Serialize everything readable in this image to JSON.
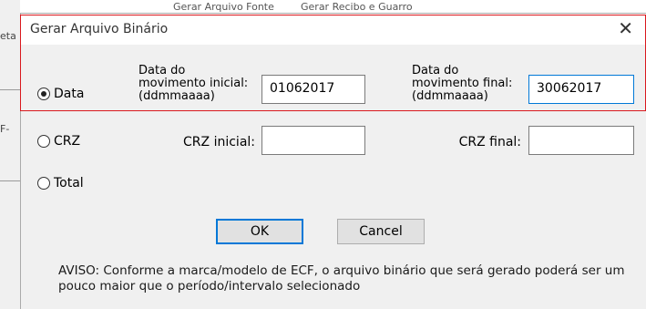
{
  "background": {
    "fragments": [
      "eta",
      "F-"
    ],
    "top_text": [
      "Gerar Arquivo Fonte",
      "Gerar Recibo e Guarro"
    ]
  },
  "dialog": {
    "title": "Gerar Arquivo Binário",
    "close_glyph": "✕",
    "options": {
      "data": {
        "label": "Data",
        "checked": true
      },
      "crz": {
        "label": "CRZ",
        "checked": false
      },
      "total": {
        "label": "Total",
        "checked": false
      }
    },
    "data_row": {
      "initial_label": [
        "Data do",
        "movimento inicial:",
        "(ddmmaaaa)"
      ],
      "initial_value": "01062017",
      "final_label": [
        "Data do",
        "movimento final:",
        "(ddmmaaaa)"
      ],
      "final_value": "30062017"
    },
    "crz_row": {
      "initial_label": "CRZ inicial:",
      "initial_value": "",
      "final_label": "CRZ final:",
      "final_value": ""
    },
    "buttons": {
      "ok": "OK",
      "cancel": "Cancel"
    },
    "notice": "AVISO: Conforme a marca/modelo de ECF, o arquivo binário que será gerado poderá ser um pouco maior que o período/intervalo selecionado"
  },
  "colors": {
    "highlight": "#d9181d",
    "focus": "#0078d7"
  }
}
